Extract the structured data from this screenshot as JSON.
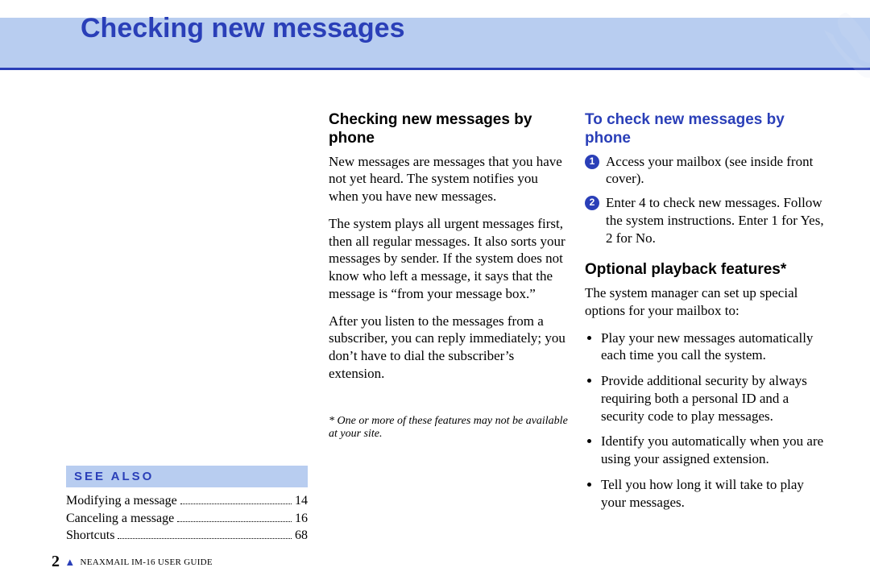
{
  "header": {
    "title": "Checking new messages"
  },
  "see_also": {
    "heading": "SEE ALSO",
    "items": [
      {
        "label": "Modifying a message",
        "page": "14"
      },
      {
        "label": "Canceling a message",
        "page": "16"
      },
      {
        "label": "Shortcuts",
        "page": "68"
      }
    ]
  },
  "col_mid": {
    "heading": "Checking new messages by phone",
    "para1": "New messages are messages that you have not yet heard. The system notifies you when you have new messages.",
    "para2": "The system plays all urgent messages first, then all regular messages. It also sorts your messages by sender. If the system does not know who left a message, it says that the message is “from your message box.”",
    "para3": "After you listen to the messages from a subscriber, you can reply immediately; you don’t have to dial the subscriber’s extension.",
    "footnote": "* One or more of these features may not be available at your site."
  },
  "col_right": {
    "heading_blue": "To check new messages by phone",
    "steps": [
      "Access your mailbox (see inside front cover).",
      "Enter 4 to check new messages. Follow the system instructions. Enter 1 for Yes, 2 for No."
    ],
    "heading2": "Optional playback features*",
    "intro": "The system manager can set up special options for your mailbox to:",
    "bullets": [
      "Play your new messages automatically each time you call the system.",
      "Provide additional security by always requiring both a personal ID and a security code to play messages.",
      "Identify you automatically when you are using your assigned extension.",
      "Tell you how long it will take to play your messages."
    ]
  },
  "footer": {
    "page": "2",
    "label": "NEAXMAIL IM-16 USER GUIDE"
  }
}
